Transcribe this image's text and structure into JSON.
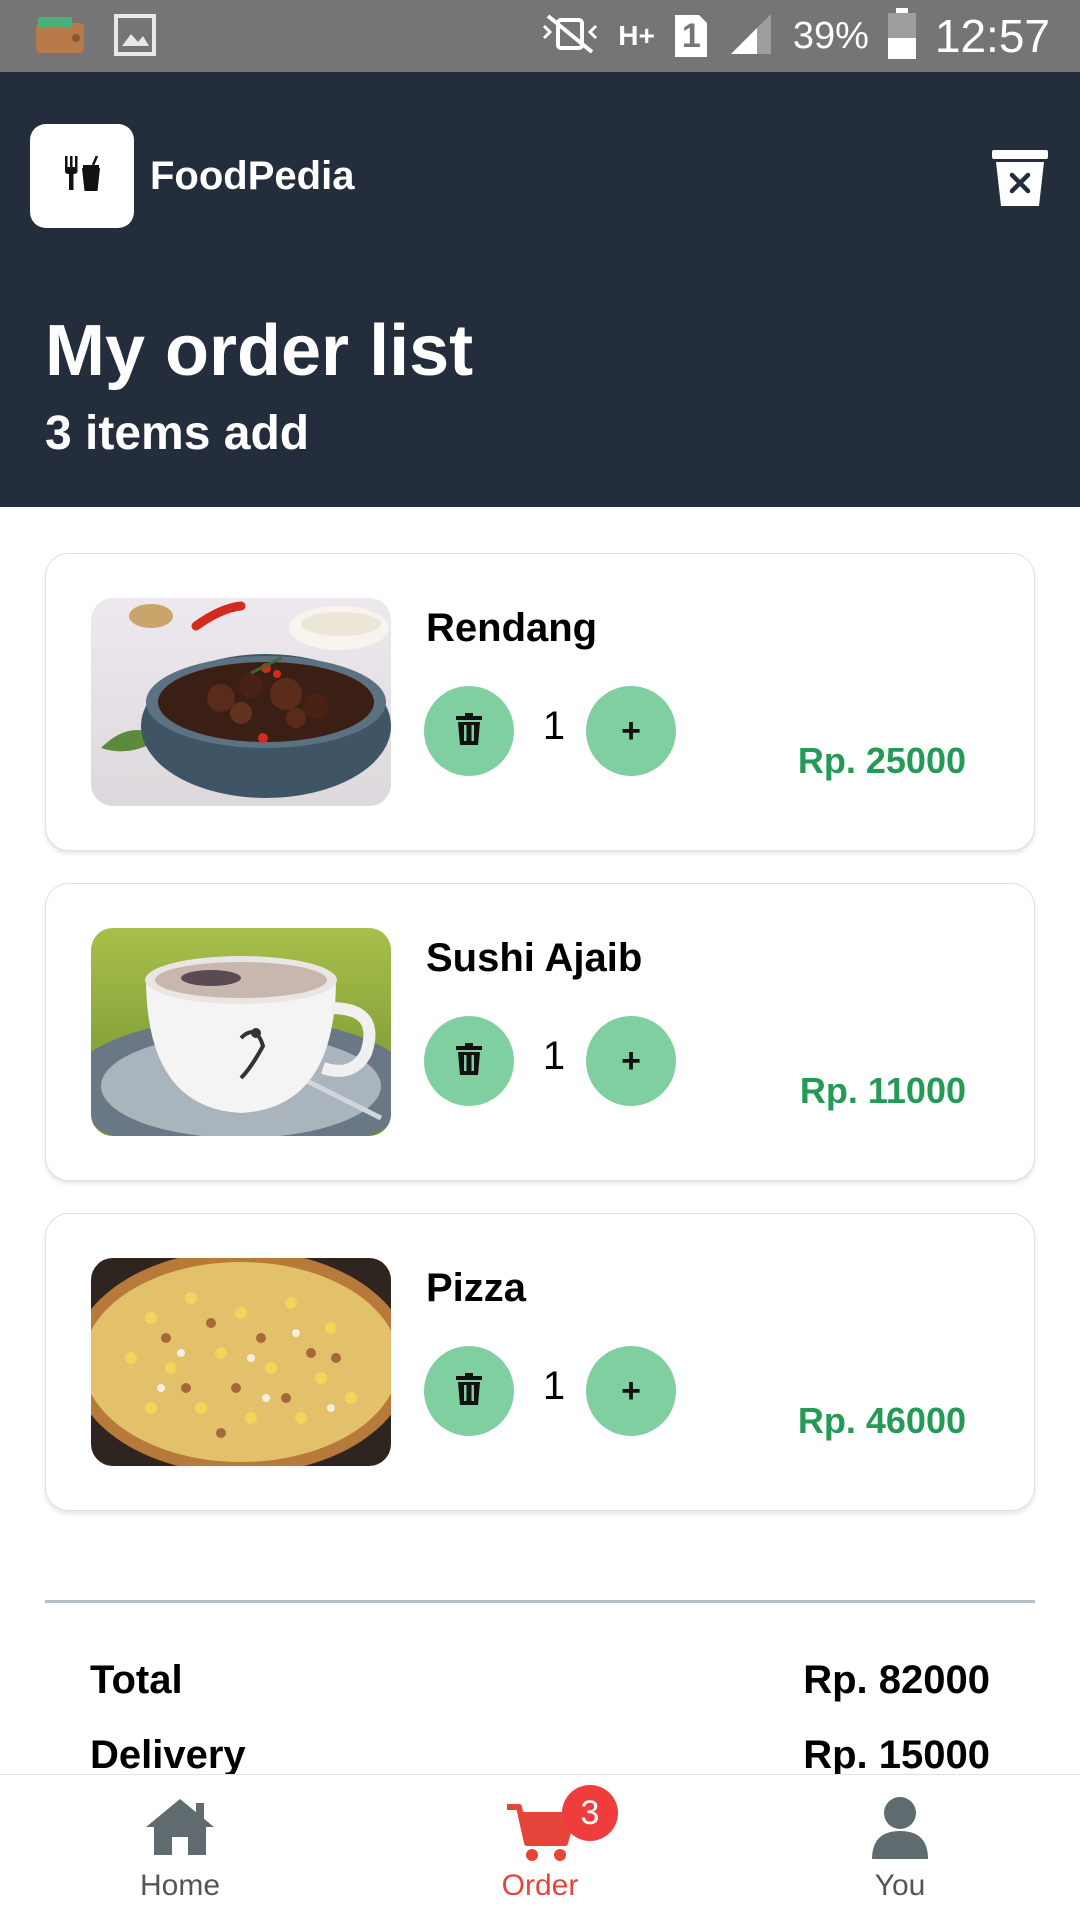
{
  "status_bar": {
    "network": "H+",
    "sim": "1",
    "battery": "39%",
    "time": "12:57"
  },
  "header": {
    "app_name": "FoodPedia",
    "title": "My order list",
    "subtitle": "3 items add",
    "logo_icon": "fork-knife-cup-icon",
    "clear_icon": "trash-clear-icon"
  },
  "orders": [
    {
      "name": "Rendang",
      "quantity": "1",
      "price": "Rp. 25000",
      "image": "rendang-bowl"
    },
    {
      "name": "Sushi Ajaib",
      "quantity": "1",
      "price": "Rp. 11000",
      "image": "coffee-cup"
    },
    {
      "name": "Pizza",
      "quantity": "1",
      "price": "Rp. 46000",
      "image": "pizza"
    }
  ],
  "buttons": {
    "add_label": "+"
  },
  "summary": {
    "total_label": "Total",
    "total_value": "Rp. 82000",
    "delivery_label": "Delivery",
    "delivery_value": "Rp. 15000"
  },
  "bottom_nav": {
    "items": [
      {
        "label": "Home",
        "icon": "home-icon"
      },
      {
        "label": "Order",
        "icon": "cart-icon",
        "badge": "3",
        "active": true
      },
      {
        "label": "You",
        "icon": "user-icon"
      }
    ]
  },
  "colors": {
    "header_bg": "#232d3b",
    "button_green": "#7fcfa0",
    "price_green": "#239a55",
    "active_red": "#e5453a",
    "badge_red": "#ef3c3c"
  }
}
